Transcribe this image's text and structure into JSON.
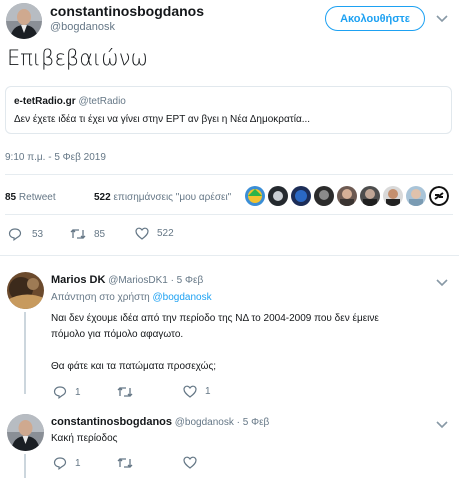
{
  "main_tweet": {
    "display_name": "constantinosbogdanos",
    "handle": "@bogdanosk",
    "follow_label": "Ακολουθήστε",
    "text": "Επιβεβαιώνω",
    "quote": {
      "display_name": "e-tetRadio.gr",
      "handle": "@tetRadio",
      "text": "Δεν έχετε ιδέα τι έχει να γίνει στην ΕΡΤ αν βγει η Νέα Δημοκρατία..."
    },
    "timestamp": "9:10 π.μ. - 5 Φεβ 2019",
    "retweets_count": "85",
    "retweets_label": "Retweet",
    "likes_count": "522",
    "likes_label": "επισημάνσεις \"μου αρέσει\"",
    "actions": {
      "replies": "53",
      "retweets": "85",
      "likes": "522"
    }
  },
  "replies": [
    {
      "display_name": "Marios DK",
      "handle": "@MariosDK1",
      "time": "· 5 Φεβ",
      "reply_to_prefix": "Απάντηση στο χρήστη",
      "reply_to_handle": "@bogdanosk",
      "text_line1": "Ναι δεν έχουμε ιδέα από την περίοδο της ΝΔ το 2004-2009 που δεν έμεινε",
      "text_line2": "πόμολο για πόμολο αφαγωτο.",
      "text_line3": "Θα φάτε και τα πατώματα προσεχώς;",
      "actions": {
        "replies": "1",
        "retweets": "",
        "likes": "1"
      }
    },
    {
      "display_name": "constantinosbogdanos",
      "handle": "@bogdanosk",
      "time": "· 5 Φεβ",
      "text_line1": "Κακή περίοδος",
      "actions": {
        "replies": "1",
        "retweets": "",
        "likes": ""
      }
    }
  ],
  "colors": {
    "accent": "#1da1f2",
    "text": "#14171a",
    "muted": "#657786",
    "border": "#e6ecf0",
    "retweet": "#17bf63",
    "like": "#e0245e"
  },
  "icons": [
    "reply-icon",
    "retweet-icon",
    "heart-icon",
    "chevron-down-icon"
  ]
}
